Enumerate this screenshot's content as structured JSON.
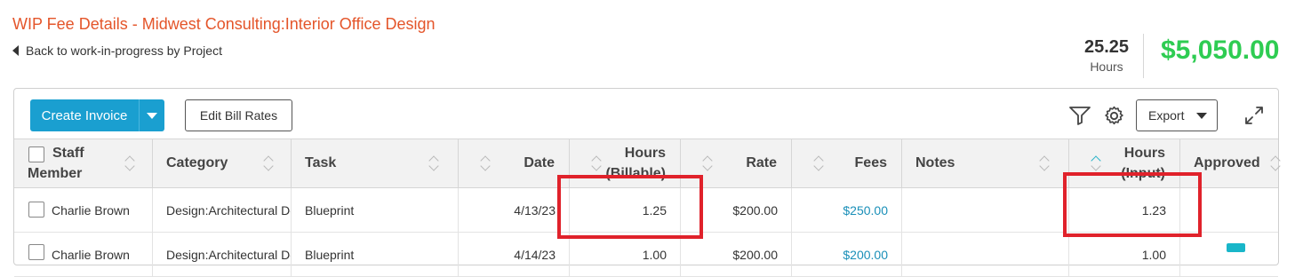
{
  "header": {
    "title": "WIP Fee Details - Midwest Consulting:Interior Office Design",
    "back_link": "Back to work-in-progress by Project"
  },
  "summary": {
    "hours_value": "25.25",
    "hours_label": "Hours",
    "fees_value": "$5,050.00",
    "fees_color": "#2ecc52"
  },
  "toolbar": {
    "create_invoice": "Create Invoice",
    "edit_bill_rates": "Edit Bill Rates",
    "export": "Export",
    "icons": [
      "filter-icon",
      "gear-icon",
      "expand-icon"
    ]
  },
  "table": {
    "columns": [
      {
        "label": "Staff Member"
      },
      {
        "label": "Category"
      },
      {
        "label": "Task"
      },
      {
        "label": "Date"
      },
      {
        "label": "Hours (Billable)"
      },
      {
        "label": "Rate"
      },
      {
        "label": "Fees"
      },
      {
        "label": "Notes"
      },
      {
        "label": "Hours (Input)"
      },
      {
        "label": "Approved"
      }
    ],
    "rows": [
      {
        "staff": "Charlie Brown",
        "category": "Design:Architectural Design",
        "task": "Blueprint",
        "date": "4/13/23",
        "hours_billable": "1.25",
        "rate": "$200.00",
        "fees": "$250.00",
        "notes": "",
        "hours_input": "1.23",
        "approved": ""
      },
      {
        "staff": "Charlie Brown",
        "category": "Design:Architectural Design",
        "task": "Blueprint",
        "date": "4/14/23",
        "hours_billable": "1.00",
        "rate": "$200.00",
        "fees": "$200.00",
        "notes": "",
        "hours_input": "1.00",
        "approved": ""
      }
    ]
  },
  "colors": {
    "title": "#e4552a",
    "primary_button": "#1a9fd0",
    "link": "#1a8fb8",
    "highlight_box": "#e0222b",
    "sort_active": "#2ab3c8"
  }
}
